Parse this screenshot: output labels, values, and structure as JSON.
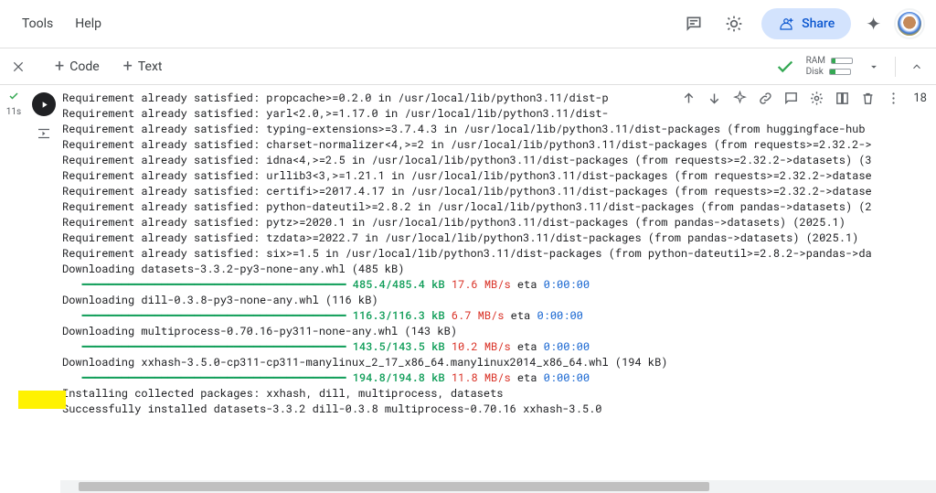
{
  "header": {
    "menu": {
      "tools": "Tools",
      "help": "Help"
    },
    "share_label": "Share"
  },
  "toolbar": {
    "insert_code": "Code",
    "insert_text": "Text",
    "ram_label": "RAM",
    "disk_label": "Disk"
  },
  "cell": {
    "exec_time": "11s",
    "line_count": "18"
  },
  "output": {
    "lines": [
      {
        "t": "Requirement already satisfied: propcache>=0.2.0 in /usr/local/lib/python3.11/dist-p"
      },
      {
        "t": "Requirement already satisfied: yarl<2.0,>=1.17.0 in /usr/local/lib/python3.11/dist-"
      },
      {
        "t": "Requirement already satisfied: typing-extensions>=3.7.4.3 in /usr/local/lib/python3.11/dist-packages (from huggingface-hub"
      },
      {
        "t": "Requirement already satisfied: charset-normalizer<4,>=2 in /usr/local/lib/python3.11/dist-packages (from requests>=2.32.2->"
      },
      {
        "t": "Requirement already satisfied: idna<4,>=2.5 in /usr/local/lib/python3.11/dist-packages (from requests>=2.32.2->datasets) (3"
      },
      {
        "t": "Requirement already satisfied: urllib3<3,>=1.21.1 in /usr/local/lib/python3.11/dist-packages (from requests>=2.32.2->datase"
      },
      {
        "t": "Requirement already satisfied: certifi>=2017.4.17 in /usr/local/lib/python3.11/dist-packages (from requests>=2.32.2->datase"
      },
      {
        "t": "Requirement already satisfied: python-dateutil>=2.8.2 in /usr/local/lib/python3.11/dist-packages (from pandas->datasets) (2"
      },
      {
        "t": "Requirement already satisfied: pytz>=2020.1 in /usr/local/lib/python3.11/dist-packages (from pandas->datasets) (2025.1)"
      },
      {
        "t": "Requirement already satisfied: tzdata>=2022.7 in /usr/local/lib/python3.11/dist-packages (from pandas->datasets) (2025.1)"
      },
      {
        "t": "Requirement already satisfied: six>=1.5 in /usr/local/lib/python3.11/dist-packages (from python-dateutil>=2.8.2->pandas->da"
      },
      {
        "t": "Downloading datasets-3.3.2-py3-none-any.whl (485 kB)"
      },
      {
        "prog": {
          "bar": "━━━━━━━━━━━━━━━━━━━━━━━━━━━━━━━━━━━━━━━━",
          "size": "485.4/485.4 kB",
          "speed": "17.6 MB/s",
          "eta_lbl": "eta",
          "eta": "0:00:00"
        }
      },
      {
        "t": "Downloading dill-0.3.8-py3-none-any.whl (116 kB)"
      },
      {
        "prog": {
          "bar": "━━━━━━━━━━━━━━━━━━━━━━━━━━━━━━━━━━━━━━━━",
          "size": "116.3/116.3 kB",
          "speed": "6.7 MB/s",
          "eta_lbl": "eta",
          "eta": "0:00:00"
        }
      },
      {
        "t": "Downloading multiprocess-0.70.16-py311-none-any.whl (143 kB)"
      },
      {
        "prog": {
          "bar": "━━━━━━━━━━━━━━━━━━━━━━━━━━━━━━━━━━━━━━━━",
          "size": "143.5/143.5 kB",
          "speed": "10.2 MB/s",
          "eta_lbl": "eta",
          "eta": "0:00:00"
        }
      },
      {
        "t": "Downloading xxhash-3.5.0-cp311-cp311-manylinux_2_17_x86_64.manylinux2014_x86_64.whl (194 kB)"
      },
      {
        "prog": {
          "bar": "━━━━━━━━━━━━━━━━━━━━━━━━━━━━━━━━━━━━━━━━",
          "size": "194.8/194.8 kB",
          "speed": "11.8 MB/s",
          "eta_lbl": "eta",
          "eta": "0:00:00"
        }
      },
      {
        "t": "Installing collected packages: xxhash, dill, multiprocess, datasets"
      },
      {
        "t": "Successfully installed datasets-3.3.2 dill-0.3.8 multiprocess-0.70.16 xxhash-3.5.0"
      }
    ]
  }
}
